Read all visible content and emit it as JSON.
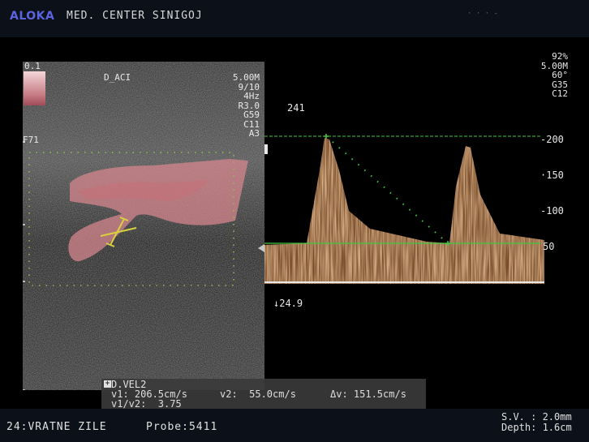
{
  "header": {
    "brand": "ALOKA",
    "center_name": "MED. CENTER SINIGOJ",
    "right_text": "·  ·  ·  -"
  },
  "bmode": {
    "color_scale_top": "0.1",
    "label": "D_ACI",
    "left_label": "F71",
    "params": [
      "5.00M",
      "9/10",
      "4Hz",
      "R3.0",
      "G59",
      "C11",
      "A3"
    ]
  },
  "doppler": {
    "params": [
      "92%",
      "5.00M",
      "60°",
      "G35",
      "C12"
    ],
    "peak_label": "241",
    "baseline_label": "↓24.9",
    "axis_ticks": [
      "-200",
      "·150",
      "-100",
      "50"
    ]
  },
  "measurement": {
    "title": "D.VEL2",
    "v1": "v1: 206.5cm/s",
    "v2": "v2:  55.0cm/s",
    "dv": "Δv: 151.5cm/s",
    "ratio": "v1/v2:  3.75"
  },
  "footer": {
    "exam": "24:VRATNE ZILE",
    "probe": "Probe:5411",
    "sv": "S.V. : 2.0mm",
    "depth": "Depth: 1.6cm"
  },
  "colors": {
    "brand": "#5b64e0",
    "accent_green": "#42c842",
    "color_flow": "#d8888f",
    "doppler": "#b07a50"
  }
}
